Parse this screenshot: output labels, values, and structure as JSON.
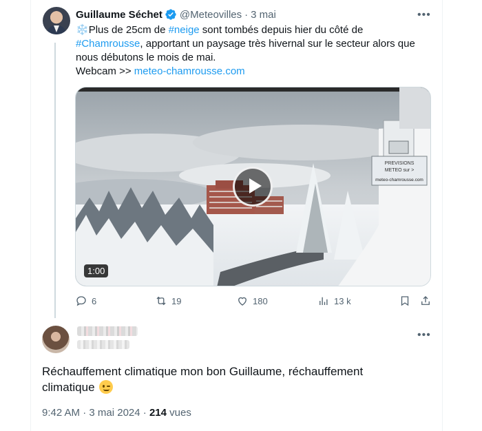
{
  "quoted_tweet": {
    "author_name": "Guillaume Séchet",
    "handle": "@Meteovilles",
    "separator": "·",
    "date": "3 mai",
    "more_icon": "more-icon",
    "text_line1_post": "Plus de 25cm de ",
    "hashtag_neige": "#neige",
    "text_line1_end": " sont tombés depuis hier du côté de",
    "hashtag_chamrousse": "#Chamrousse",
    "text_line2": ", apportant un paysage très hivernal sur le secteur alors que",
    "text_line3": "nous débutons le mois de mai.",
    "webcam_label": "Webcam >> ",
    "webcam_link": "meteo-chamrousse.com",
    "video_duration": "1:00",
    "sign_text1": "PREVISIONS",
    "sign_text2": "METEO sur >",
    "sign_text3": "meteo-chamrousse.com",
    "actions": {
      "replies": "6",
      "reposts": "19",
      "likes": "180",
      "views": "13 k"
    }
  },
  "reply": {
    "text_line1": "Réchauffement climatique mon bon Guillaume, réchauffement",
    "text_line2": "climatique "
  },
  "meta": {
    "time": "9:42 AM",
    "separator": " · ",
    "date": "3 mai 2024",
    "separator2": " · ",
    "views_count": "214",
    "views_label": " vues"
  },
  "colors": {
    "link": "#1d9bf0",
    "text": "#0f1419",
    "secondary": "#536471"
  }
}
